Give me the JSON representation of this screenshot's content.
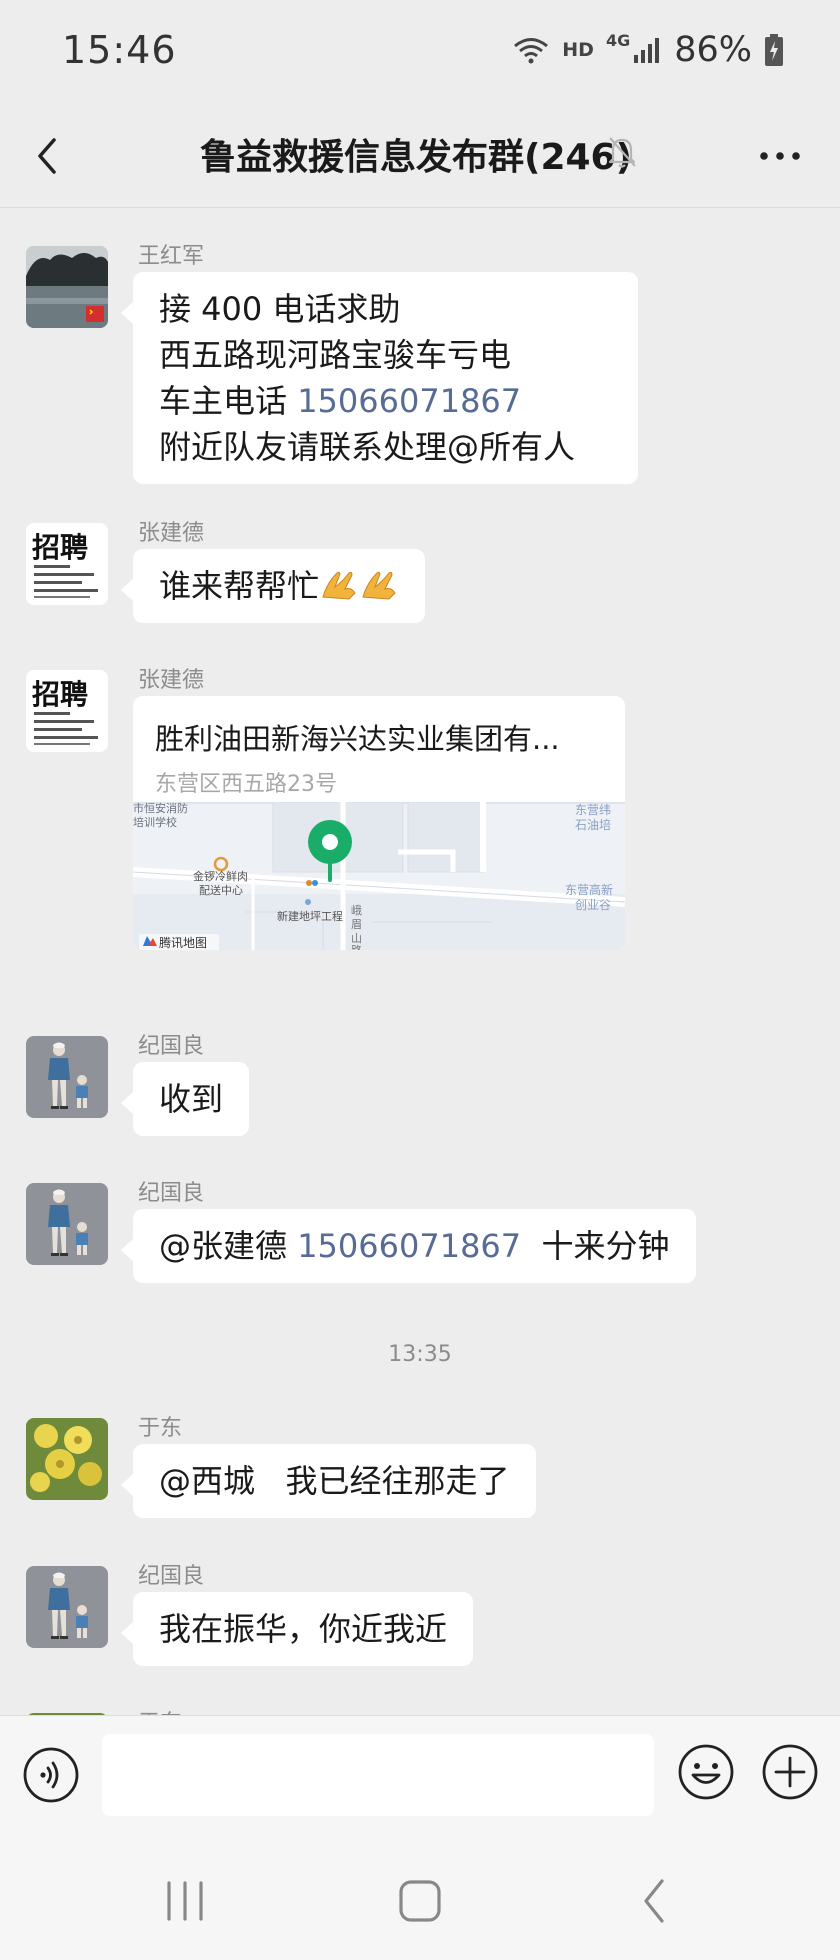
{
  "status_bar": {
    "time": "15:46",
    "network_hd": "HD",
    "network_type": "4G",
    "battery": "86%"
  },
  "nav": {
    "title": "鲁益救援信息发布群(246)",
    "icons": [
      "back-arrow-icon",
      "mute-bell-icon",
      "more-icon"
    ]
  },
  "messages": [
    {
      "sender": "王红军",
      "avatar": "lake-photo-avatar",
      "lines": [
        "接 400 电话求助",
        "西五路现河路宝骏车亏电"
      ],
      "phone_prefix": "车主电话 ",
      "phone": "15066071867",
      "last_line": "附近队友请联系处理@所有人"
    },
    {
      "sender": "张建德",
      "avatar": "recruit-poster-avatar",
      "text": "谁来帮帮忙",
      "emoji": "pray-hands-emoji"
    },
    {
      "sender": "张建德",
      "avatar": "recruit-poster-avatar",
      "location": {
        "title": "胜利油田新海兴达实业集团有...",
        "address": "东营区西五路23号",
        "map_labels": {
          "school": "市恒安消防\n培训学校",
          "cold": "金锣冷鲜肉\n配送中心",
          "proj": "新建地坪工程",
          "road": "峨眉山路",
          "tr_top": "东营纬",
          "tr_top2": "石油培",
          "tr_mid": "东营高新",
          "tr_mid2": "创业谷",
          "brand": "腾讯地图"
        }
      }
    },
    {
      "sender": "纪国良",
      "avatar": "parent-child-avatar",
      "text": "收到"
    },
    {
      "sender": "纪国良",
      "avatar": "parent-child-avatar",
      "mention": "@张建德 ",
      "phone": "15066071867",
      "suffix": "  十来分钟"
    },
    {
      "time_divider": "13:35"
    },
    {
      "sender": "于东",
      "avatar": "yellow-flowers-avatar",
      "text": "@西城   我已经往那走了"
    },
    {
      "sender": "纪国良",
      "avatar": "parent-child-avatar",
      "text": "我在振华，你近我近"
    },
    {
      "sender": "于东",
      "avatar": "yellow-flowers-avatar",
      "partial": true
    }
  ],
  "input_bar": {
    "placeholder": "",
    "icons": [
      "voice-icon",
      "emoji-icon",
      "plus-icon"
    ]
  },
  "system_nav": {
    "icons": [
      "recent-apps-icon",
      "home-icon",
      "system-back-icon"
    ]
  },
  "colors": {
    "background": "#ededed",
    "bubble": "#ffffff",
    "link": "#576b95",
    "pin": "#07c160"
  }
}
